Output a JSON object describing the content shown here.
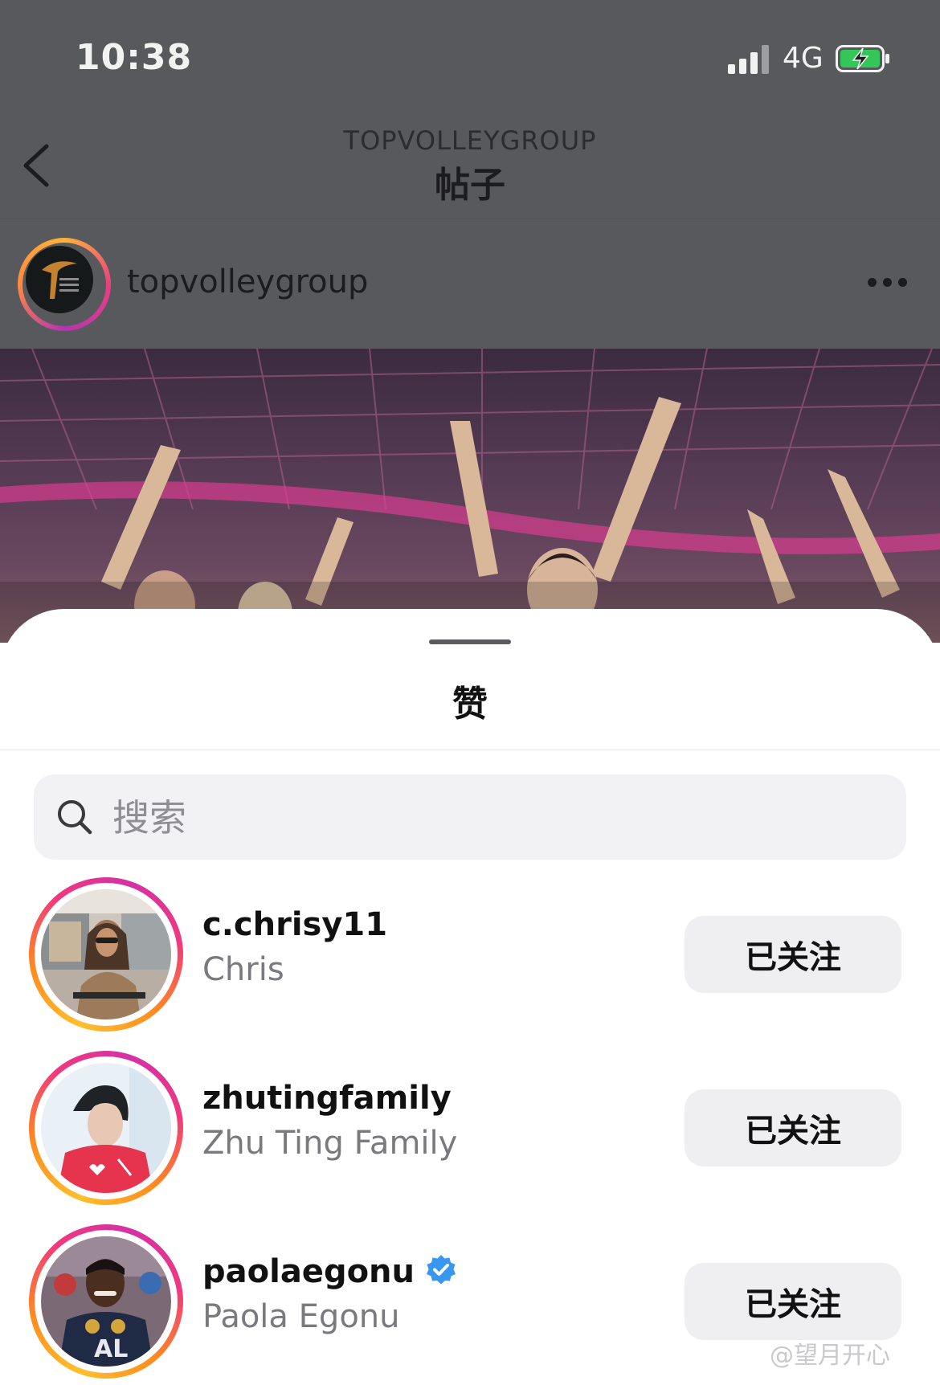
{
  "status_bar": {
    "time": "10:38",
    "network": "4G",
    "icons": [
      "signal-icon",
      "battery-charging-icon"
    ]
  },
  "nav": {
    "subtitle": "TOPVOLLEYGROUP",
    "title": "帖子",
    "back_icon": "chevron-left-icon"
  },
  "post": {
    "username": "topvolleygroup",
    "more_icon": "more-horizontal-icon"
  },
  "likes_sheet": {
    "title": "赞",
    "search": {
      "placeholder": "搜索",
      "value": "",
      "icon": "search-icon"
    },
    "users": [
      {
        "handle": "c.chrisy11",
        "name": "Chris",
        "verified": false,
        "button": "已关注"
      },
      {
        "handle": "zhutingfamily",
        "name": "Zhu Ting Family",
        "verified": false,
        "button": "已关注"
      },
      {
        "handle": "paolaegonu",
        "name": "Paola Egonu",
        "verified": true,
        "button": "已关注"
      }
    ]
  },
  "watermark": "@望月开心",
  "colors": {
    "dim_overlay": "#58595c",
    "accent_blue": "#3897f0",
    "story_ring": [
      "#ffc02e",
      "#f0387f",
      "#d431a5"
    ]
  }
}
